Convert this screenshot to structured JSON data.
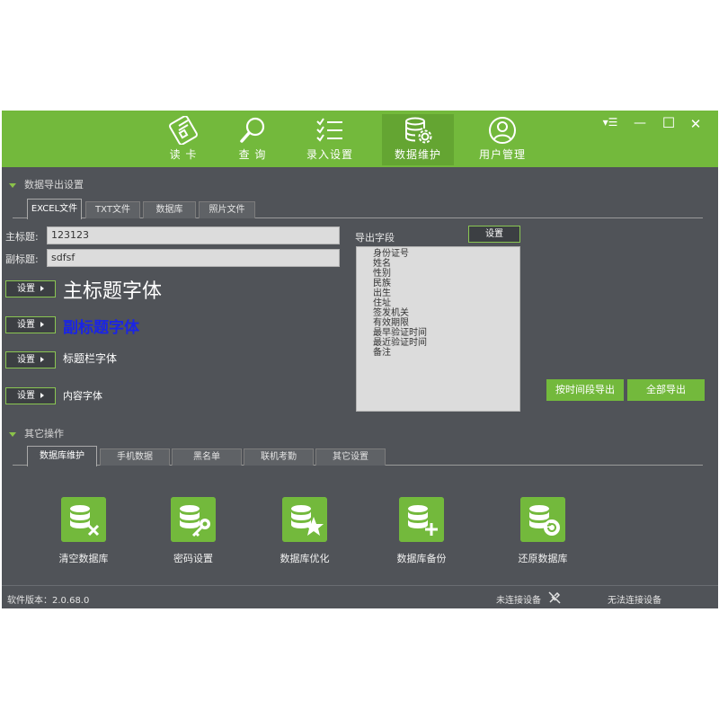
{
  "nav": {
    "items": [
      {
        "label": "读 卡",
        "icon": "id-card-icon"
      },
      {
        "label": "查 询",
        "icon": "search-icon"
      },
      {
        "label": "录入设置",
        "icon": "checklist-icon"
      },
      {
        "label": "数据维护",
        "icon": "database-gear-icon",
        "active": true
      },
      {
        "label": "用户管理",
        "icon": "user-icon"
      }
    ],
    "window_controls": {
      "menu": "▾☰",
      "minimize": "—",
      "maximize": "☐",
      "close": "✕"
    }
  },
  "export": {
    "section_title": "数据导出设置",
    "tabs": [
      "EXCEL文件",
      "TXT文件",
      "数据库",
      "照片文件"
    ],
    "active_tab": 0,
    "main_title_label": "主标题:",
    "main_title_value": "123123",
    "subtitle_label": "副标题:",
    "subtitle_value": "sdfsf",
    "set_label": "设置",
    "font_rows": [
      {
        "sample": "主标题字体"
      },
      {
        "sample": "副标题字体"
      },
      {
        "sample": "标题栏字体"
      },
      {
        "sample": "内容字体"
      }
    ],
    "fields_label": "导出字段",
    "fields_set_label": "设置",
    "fields": [
      "身份证号",
      "姓名",
      "性别",
      "民族",
      "出生",
      "住址",
      "签发机关",
      "有效期限",
      "最早验证时间",
      "最近验证时间",
      "备注"
    ],
    "export_by_time_label": "按时间段导出",
    "export_all_label": "全部导出"
  },
  "other": {
    "section_title": "其它操作",
    "tabs": [
      "数据库维护",
      "手机数据",
      "黑名单",
      "联机考勤",
      "其它设置"
    ],
    "active_tab": 0,
    "operations": [
      {
        "label": "清空数据库",
        "icon": "database-clear-icon"
      },
      {
        "label": "密码设置",
        "icon": "database-key-icon"
      },
      {
        "label": "数据库优化",
        "icon": "database-star-icon"
      },
      {
        "label": "数据库备份",
        "icon": "database-add-icon"
      },
      {
        "label": "还原数据库",
        "icon": "database-restore-icon"
      }
    ]
  },
  "status": {
    "version": "软件版本：2.0.68.0",
    "device_status": "未连接设备",
    "connection_status": "无法连接设备"
  },
  "colors": {
    "accent": "#73b93c",
    "accent_dark": "#64a532",
    "background": "#505358",
    "subtitle_font_color": "#1a24e6"
  }
}
